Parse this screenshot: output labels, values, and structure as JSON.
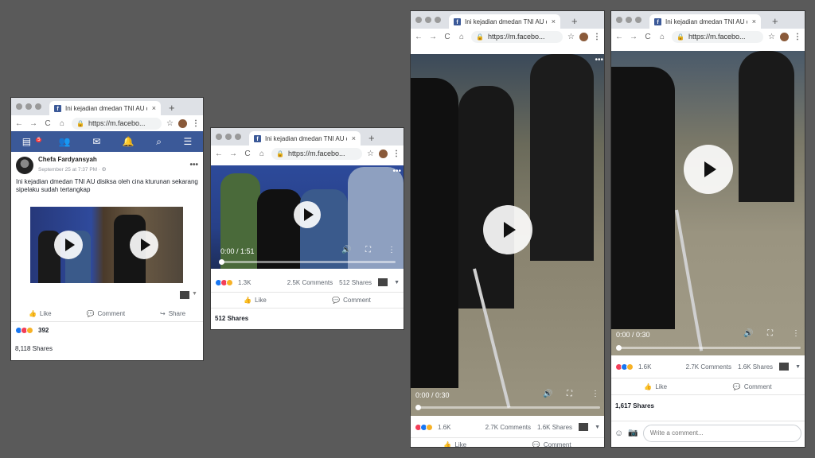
{
  "browser": {
    "tab_title": "Ini kejadian dmedan TNI AU di",
    "url": "https://m.facebo...",
    "new_tab": "+",
    "close": "×",
    "back": "←",
    "forward": "→",
    "reload": "C",
    "home": "⌂",
    "star": "☆",
    "menu": "⋮"
  },
  "fb_nav": {
    "notification_count": "5"
  },
  "post": {
    "author": "Chefa Fardyansyah",
    "meta": "September 25 at 7:37 PM · 🜨",
    "text": "Ini kejadian dmedan TNI AU disiksa oleh cina kturunan sekarang sipelaku sudah tertangkap",
    "more": "•••",
    "like_label": "Like",
    "comment_label": "Comment",
    "share_label": "Share",
    "reaction_count": "392",
    "shares": "8,118 Shares"
  },
  "video2": {
    "time": "0:00 / 1:51",
    "reaction_count": "1.3K",
    "comments": "2.5K Comments",
    "shares_inline": "512 Shares",
    "like_label": "Like",
    "comment_label": "Comment",
    "shares": "512 Shares",
    "more": "•••"
  },
  "video3": {
    "time": "0:00 / 0:30",
    "reaction_count": "1.6K",
    "comments": "2.7K Comments",
    "shares_inline": "1.6K Shares",
    "like_label": "Like",
    "comment_label": "Comment",
    "more": "•••"
  },
  "video4": {
    "time": "0:00 / 0:30",
    "reaction_count": "1.6K",
    "comments": "2.7K Comments",
    "shares_inline": "1.6K Shares",
    "like_label": "Like",
    "comment_label": "Comment",
    "shares": "1,617 Shares",
    "comment_placeholder": "Write a comment..."
  },
  "colors": {
    "background": "#5a5a5a",
    "facebook_blue": "#3b5998",
    "like_blue": "#1877f2",
    "love_red": "#f33e58",
    "wow_yellow": "#f7b125"
  }
}
